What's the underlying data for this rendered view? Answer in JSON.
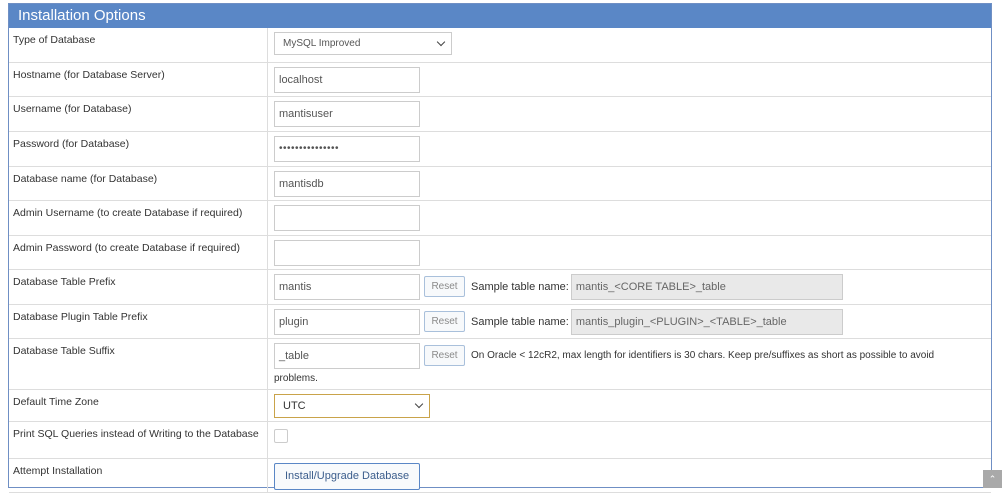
{
  "panel": {
    "title": "Installation Options"
  },
  "rows": {
    "db_type": {
      "label": "Type of Database",
      "value": "MySQL Improved"
    },
    "hostname": {
      "label": "Hostname (for Database Server)",
      "value": "localhost"
    },
    "username": {
      "label": "Username (for Database)",
      "value": "mantisuser"
    },
    "password": {
      "label": "Password (for Database)",
      "value": "•••••••••••••••"
    },
    "db_name": {
      "label": "Database name (for Database)",
      "value": "mantisdb"
    },
    "admin_username": {
      "label": "Admin Username (to create Database if required)",
      "value": ""
    },
    "admin_password": {
      "label": "Admin Password (to create Database if required)",
      "value": ""
    },
    "table_prefix": {
      "label": "Database Table Prefix",
      "value": "mantis",
      "reset": "Reset",
      "sample_label": "Sample table name:",
      "sample_value": "mantis_<CORE TABLE>_table"
    },
    "plugin_prefix": {
      "label": "Database Plugin Table Prefix",
      "value": "plugin",
      "reset": "Reset",
      "sample_label": "Sample table name:",
      "sample_value": "mantis_plugin_<PLUGIN>_<TABLE>_table"
    },
    "table_suffix": {
      "label": "Database Table Suffix",
      "value": "_table",
      "reset": "Reset",
      "note_line1": "On Oracle < 12cR2, max length for identifiers is 30 chars. Keep pre/suffixes as short as possible to avoid",
      "note_line2": "problems."
    },
    "timezone": {
      "label": "Default Time Zone",
      "value": "UTC"
    },
    "print_sql": {
      "label": "Print SQL Queries instead of Writing to the Database",
      "checked": false
    },
    "install": {
      "label": "Attempt Installation",
      "button": "Install/Upgrade Database"
    }
  },
  "scroll_top": {
    "icon": "double-chevron-up-icon",
    "glyph": "⌃"
  },
  "colors": {
    "header_bg": "#5a87c6",
    "border": "#dddddd",
    "timezone_focus": "#c9a34a"
  }
}
